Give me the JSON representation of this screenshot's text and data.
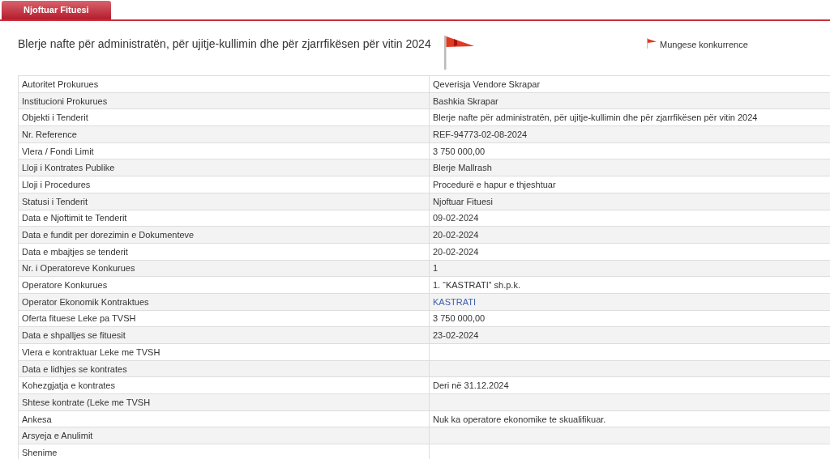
{
  "tabs": [
    {
      "label": "Njoftuar Fituesi",
      "selected": true
    }
  ],
  "title": "Blerje nafte për administratën, për ujitje-kullimin dhe për zjarrfikësen për vitin 2024",
  "flag_legend": "Mungese konkurrence",
  "rows": [
    {
      "label": "Autoritet Prokurues",
      "value": "Qeverisja Vendore Skrapar",
      "kind": "text"
    },
    {
      "label": "Institucioni Prokurues",
      "value": "Bashkia Skrapar",
      "kind": "text"
    },
    {
      "label": "Objekti i Tenderit",
      "value": "Blerje nafte për administratën, për ujitje-kullimin dhe për zjarrfikësen për vitin 2024",
      "kind": "text"
    },
    {
      "label": "Nr. Reference",
      "value": "REF-94773-02-08-2024",
      "kind": "text"
    },
    {
      "label": "Vlera / Fondi Limit",
      "value": "3 750 000,00",
      "kind": "text"
    },
    {
      "label": "Lloji i Kontrates Publike",
      "value": "Blerje Mallrash",
      "kind": "text"
    },
    {
      "label": "Lloji i Procedures",
      "value": "Procedurë e hapur e thjeshtuar",
      "kind": "text"
    },
    {
      "label": "Statusi i Tenderit",
      "value": "Njoftuar Fituesi",
      "kind": "text"
    },
    {
      "label": "Data e Njoftimit te Tenderit",
      "value": "09-02-2024",
      "kind": "text"
    },
    {
      "label": "Data e fundit per dorezimin e Dokumenteve",
      "value": "20-02-2024",
      "kind": "text"
    },
    {
      "label": "Data e mbajtjes se tenderit",
      "value": "20-02-2024",
      "kind": "text"
    },
    {
      "label": "Nr. i Operatoreve Konkurues",
      "value": "1",
      "kind": "text"
    },
    {
      "label": "Operatore Konkurues",
      "value": "1. “KASTRATI” sh.p.k.",
      "kind": "text"
    },
    {
      "label": "Operator Ekonomik Kontraktues",
      "value": "KASTRATI",
      "kind": "link"
    },
    {
      "label": "Oferta fituese Leke pa TVSH",
      "value": "3 750 000,00",
      "kind": "text"
    },
    {
      "label": "Data e shpalljes se fituesit",
      "value": "23-02-2024",
      "kind": "text"
    },
    {
      "label": "Vlera e kontraktuar Leke me TVSH"
    },
    {
      "label": "Data e lidhjes se kontrates"
    },
    {
      "label": "Kohezgjatja e kontrates",
      "value": "Deri në 31.12.2024",
      "kind": "text"
    },
    {
      "label": "Shtese kontrate (Leke me TVSH"
    },
    {
      "label": "Ankesa",
      "value": "Nuk ka operatore ekonomike te skualifikuar.",
      "kind": "text"
    },
    {
      "label": "Arsyeja e Anulimit"
    },
    {
      "label": "Shenime"
    }
  ]
}
